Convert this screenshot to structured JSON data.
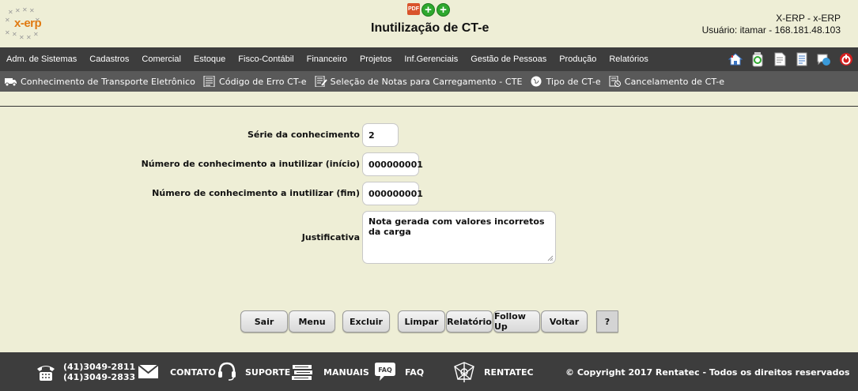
{
  "header": {
    "logo_text": "x-erp",
    "title": "Inutilização de CT-e",
    "system_line": "X-ERP - x-ERP",
    "user_line": "Usuário: itamar - 168.181.48.103",
    "icons": [
      "pdf-icon",
      "add-icon",
      "add-icon"
    ]
  },
  "mainmenu": {
    "items": [
      "Adm. de Sistemas",
      "Cadastros",
      "Comercial",
      "Estoque",
      "Fisco-Contábil",
      "Financeiro",
      "Projetos",
      "Inf.Gerenciais",
      "Gestão de Pessoas",
      "Produção",
      "Relatórios"
    ],
    "icons": [
      "home-icon",
      "recycle-icon",
      "document-icon",
      "notes-icon",
      "chat-icon",
      "power-icon"
    ]
  },
  "submenu": {
    "items": [
      "Conhecimento de Transporte Eletrônico",
      "Código de Erro CT-e",
      "Seleção de Notas para Carregamento - CTE",
      "Tipo de CT-e",
      "Cancelamento de CT-e"
    ]
  },
  "form": {
    "serie_label": "Série da conhecimento",
    "serie_value": "2",
    "inicio_label": "Número de conhecimento a inutilizar (início)",
    "inicio_value": "000000001",
    "fim_label": "Número de conhecimento a inutilizar (fim)",
    "fim_value": "000000001",
    "justificativa_label": "Justificativa",
    "justificativa_value": "Nota gerada com valores incorretos da carga"
  },
  "buttons": {
    "sair": "Sair",
    "menu": "Menu",
    "excluir": "Excluir",
    "limpar": "Limpar",
    "relatorio": "Relatório",
    "followup": "Follow Up",
    "voltar": "Voltar",
    "help": "?"
  },
  "footer": {
    "phone1": "(41)3049-2811",
    "phone2": "(41)3049-2833",
    "contato": "CONTATO",
    "suporte": "SUPORTE",
    "manuais": "MANUAIS",
    "faq_badge": "FAQ",
    "faq": "FAQ",
    "rentatec": "RENTATEC",
    "copyright": "© Copyright 2017 Rentatec - Todos os direitos reservados"
  }
}
